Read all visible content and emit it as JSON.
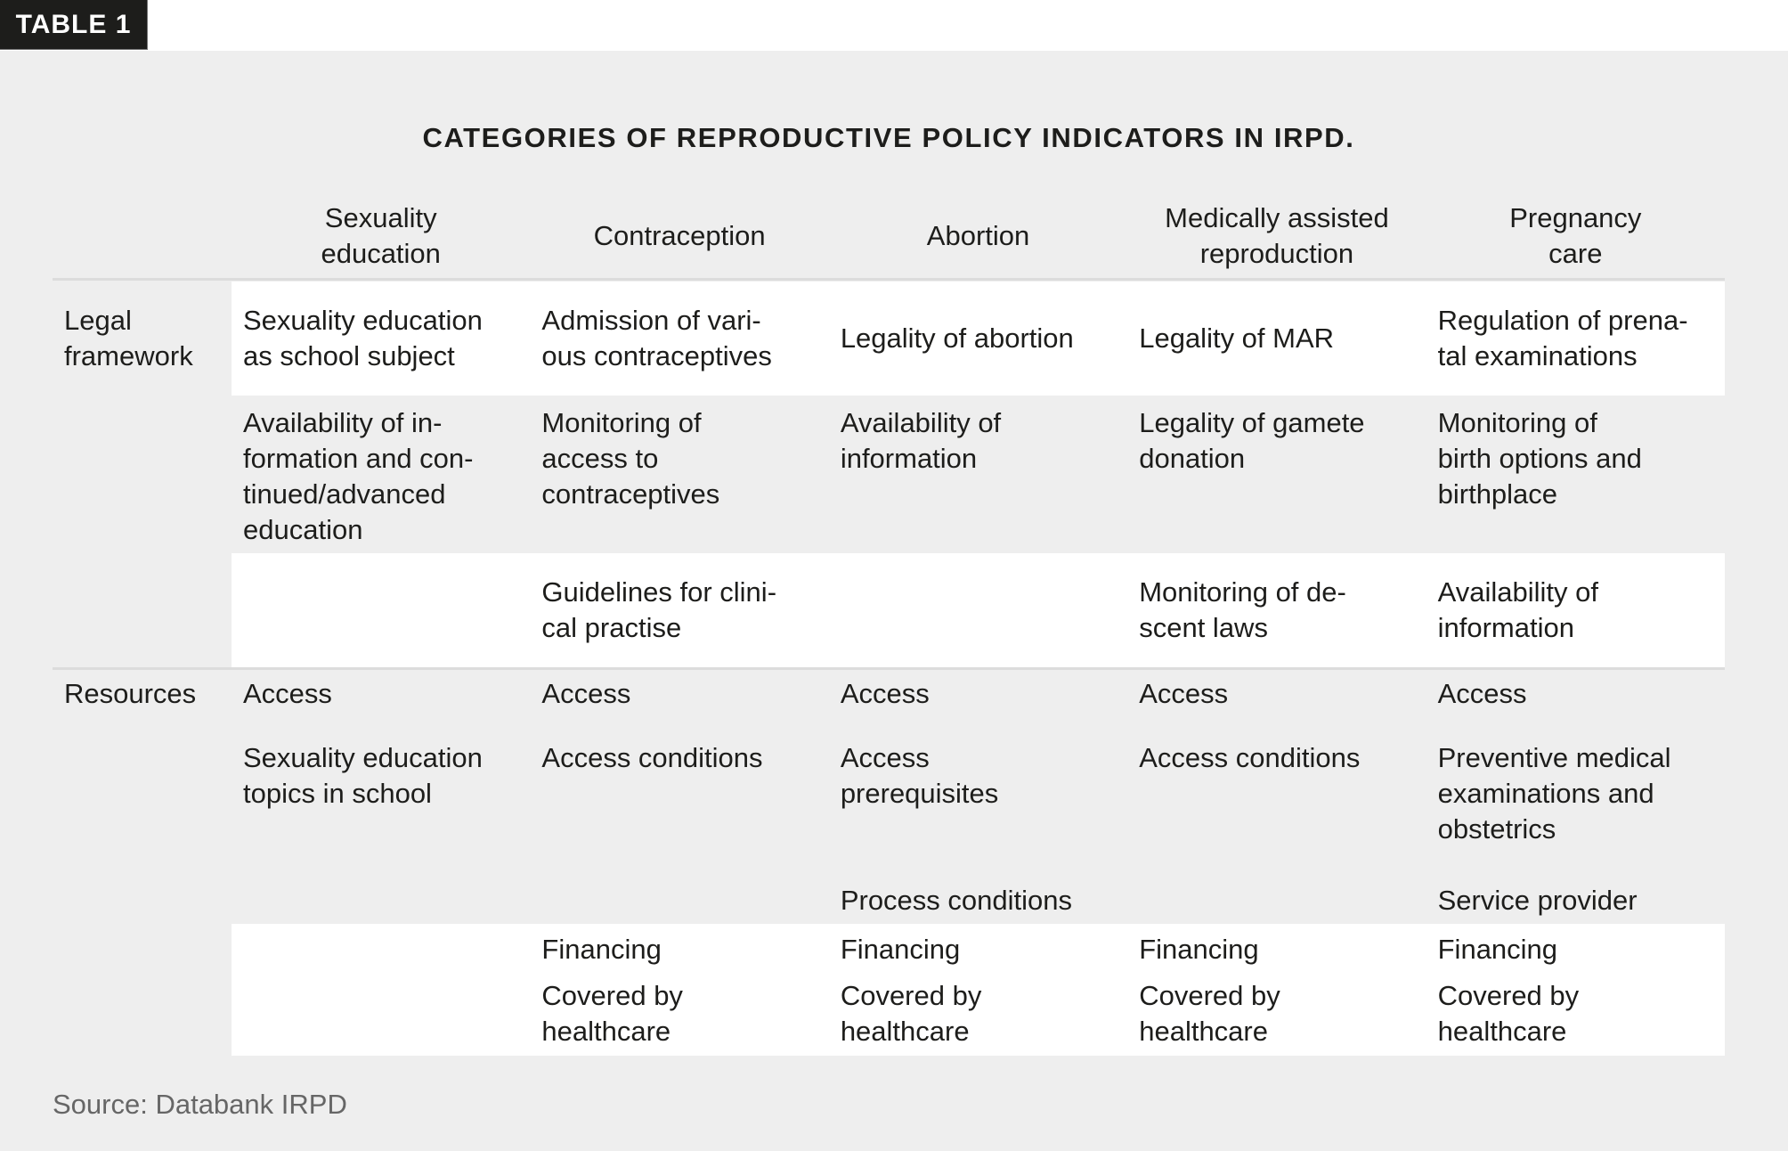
{
  "badge": "TABLE 1",
  "title": "CATEGORIES OF REPRODUCTIVE POLICY INDICATORS IN IRPD.",
  "columns": [
    "Sexuality\neducation",
    "Contraception",
    "Abortion",
    "Medically assisted\nreproduction",
    "Pregnancy\ncare"
  ],
  "sections": {
    "legal": {
      "label": "Legal\nframework",
      "rows": [
        [
          "Sexuality education\nas school subject",
          "Admission of vari-\nous contraceptives",
          "Legality of abortion",
          "Legality of MAR",
          "Regulation of prena-\ntal examinations"
        ],
        [
          "Availability of in-\nformation and con-\ntinued/advanced\neducation",
          "Monitoring of\naccess to\ncontraceptives",
          "Availability of\ninformation",
          "Legality of gamete\ndonation",
          "Monitoring of\nbirth options and\nbirthplace"
        ],
        [
          "",
          "Guidelines for clini-\ncal practise",
          "",
          "Monitoring of de-\nscent laws",
          "Availability of\ninformation"
        ]
      ]
    },
    "resources": {
      "label": "Resources",
      "rows": [
        [
          "Access",
          "Access",
          "Access",
          "Access",
          "Access"
        ],
        [
          "Sexuality education\ntopics in school",
          "Access conditions",
          "Access\nprerequisites",
          "Access conditions",
          "Preventive medical\nexaminations and\nobstetrics"
        ],
        [
          "",
          "",
          "Process conditions",
          "",
          "Service provider"
        ],
        [
          [],
          [
            "Financing",
            "Covered by\nhealthcare"
          ],
          [
            "Financing",
            "Covered by\nhealthcare"
          ],
          [
            "Financing",
            "Covered by\nhealthcare"
          ],
          [
            "Financing",
            "Covered by\nhealthcare"
          ]
        ]
      ]
    }
  },
  "source": "Source: Databank IRPD",
  "colors": {
    "panel_bg": "#eeeeee",
    "highlight_bg": "#ffffff",
    "text": "#1d1d1b",
    "source_text": "#666666",
    "badge_bg": "#1d1d1b",
    "divider": "#dcdcdc"
  }
}
